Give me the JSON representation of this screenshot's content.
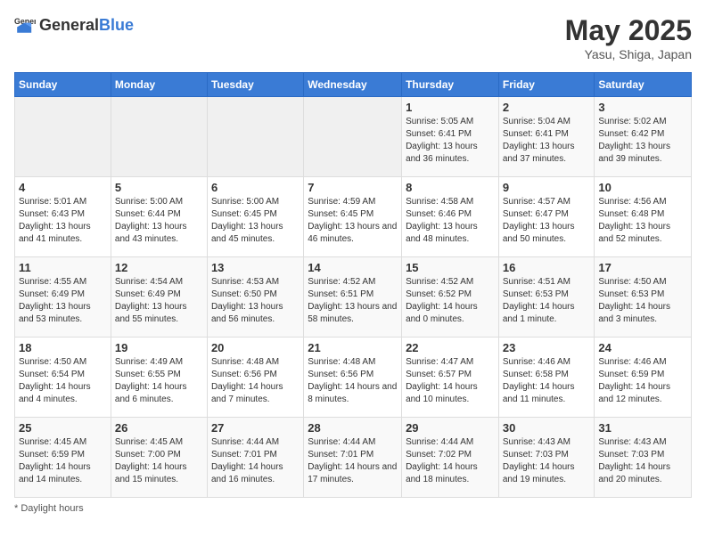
{
  "logo": {
    "text_general": "General",
    "text_blue": "Blue"
  },
  "header": {
    "month": "May 2025",
    "location": "Yasu, Shiga, Japan"
  },
  "days_of_week": [
    "Sunday",
    "Monday",
    "Tuesday",
    "Wednesday",
    "Thursday",
    "Friday",
    "Saturday"
  ],
  "footer": {
    "daylight_label": "Daylight hours"
  },
  "weeks": [
    [
      {
        "day": "",
        "sunrise": "",
        "sunset": "",
        "daylight": "",
        "empty": true
      },
      {
        "day": "",
        "sunrise": "",
        "sunset": "",
        "daylight": "",
        "empty": true
      },
      {
        "day": "",
        "sunrise": "",
        "sunset": "",
        "daylight": "",
        "empty": true
      },
      {
        "day": "",
        "sunrise": "",
        "sunset": "",
        "daylight": "",
        "empty": true
      },
      {
        "day": "1",
        "sunrise": "Sunrise: 5:05 AM",
        "sunset": "Sunset: 6:41 PM",
        "daylight": "Daylight: 13 hours and 36 minutes.",
        "empty": false
      },
      {
        "day": "2",
        "sunrise": "Sunrise: 5:04 AM",
        "sunset": "Sunset: 6:41 PM",
        "daylight": "Daylight: 13 hours and 37 minutes.",
        "empty": false
      },
      {
        "day": "3",
        "sunrise": "Sunrise: 5:02 AM",
        "sunset": "Sunset: 6:42 PM",
        "daylight": "Daylight: 13 hours and 39 minutes.",
        "empty": false
      }
    ],
    [
      {
        "day": "4",
        "sunrise": "Sunrise: 5:01 AM",
        "sunset": "Sunset: 6:43 PM",
        "daylight": "Daylight: 13 hours and 41 minutes.",
        "empty": false
      },
      {
        "day": "5",
        "sunrise": "Sunrise: 5:00 AM",
        "sunset": "Sunset: 6:44 PM",
        "daylight": "Daylight: 13 hours and 43 minutes.",
        "empty": false
      },
      {
        "day": "6",
        "sunrise": "Sunrise: 5:00 AM",
        "sunset": "Sunset: 6:45 PM",
        "daylight": "Daylight: 13 hours and 45 minutes.",
        "empty": false
      },
      {
        "day": "7",
        "sunrise": "Sunrise: 4:59 AM",
        "sunset": "Sunset: 6:45 PM",
        "daylight": "Daylight: 13 hours and 46 minutes.",
        "empty": false
      },
      {
        "day": "8",
        "sunrise": "Sunrise: 4:58 AM",
        "sunset": "Sunset: 6:46 PM",
        "daylight": "Daylight: 13 hours and 48 minutes.",
        "empty": false
      },
      {
        "day": "9",
        "sunrise": "Sunrise: 4:57 AM",
        "sunset": "Sunset: 6:47 PM",
        "daylight": "Daylight: 13 hours and 50 minutes.",
        "empty": false
      },
      {
        "day": "10",
        "sunrise": "Sunrise: 4:56 AM",
        "sunset": "Sunset: 6:48 PM",
        "daylight": "Daylight: 13 hours and 52 minutes.",
        "empty": false
      }
    ],
    [
      {
        "day": "11",
        "sunrise": "Sunrise: 4:55 AM",
        "sunset": "Sunset: 6:49 PM",
        "daylight": "Daylight: 13 hours and 53 minutes.",
        "empty": false
      },
      {
        "day": "12",
        "sunrise": "Sunrise: 4:54 AM",
        "sunset": "Sunset: 6:49 PM",
        "daylight": "Daylight: 13 hours and 55 minutes.",
        "empty": false
      },
      {
        "day": "13",
        "sunrise": "Sunrise: 4:53 AM",
        "sunset": "Sunset: 6:50 PM",
        "daylight": "Daylight: 13 hours and 56 minutes.",
        "empty": false
      },
      {
        "day": "14",
        "sunrise": "Sunrise: 4:52 AM",
        "sunset": "Sunset: 6:51 PM",
        "daylight": "Daylight: 13 hours and 58 minutes.",
        "empty": false
      },
      {
        "day": "15",
        "sunrise": "Sunrise: 4:52 AM",
        "sunset": "Sunset: 6:52 PM",
        "daylight": "Daylight: 14 hours and 0 minutes.",
        "empty": false
      },
      {
        "day": "16",
        "sunrise": "Sunrise: 4:51 AM",
        "sunset": "Sunset: 6:53 PM",
        "daylight": "Daylight: 14 hours and 1 minute.",
        "empty": false
      },
      {
        "day": "17",
        "sunrise": "Sunrise: 4:50 AM",
        "sunset": "Sunset: 6:53 PM",
        "daylight": "Daylight: 14 hours and 3 minutes.",
        "empty": false
      }
    ],
    [
      {
        "day": "18",
        "sunrise": "Sunrise: 4:50 AM",
        "sunset": "Sunset: 6:54 PM",
        "daylight": "Daylight: 14 hours and 4 minutes.",
        "empty": false
      },
      {
        "day": "19",
        "sunrise": "Sunrise: 4:49 AM",
        "sunset": "Sunset: 6:55 PM",
        "daylight": "Daylight: 14 hours and 6 minutes.",
        "empty": false
      },
      {
        "day": "20",
        "sunrise": "Sunrise: 4:48 AM",
        "sunset": "Sunset: 6:56 PM",
        "daylight": "Daylight: 14 hours and 7 minutes.",
        "empty": false
      },
      {
        "day": "21",
        "sunrise": "Sunrise: 4:48 AM",
        "sunset": "Sunset: 6:56 PM",
        "daylight": "Daylight: 14 hours and 8 minutes.",
        "empty": false
      },
      {
        "day": "22",
        "sunrise": "Sunrise: 4:47 AM",
        "sunset": "Sunset: 6:57 PM",
        "daylight": "Daylight: 14 hours and 10 minutes.",
        "empty": false
      },
      {
        "day": "23",
        "sunrise": "Sunrise: 4:46 AM",
        "sunset": "Sunset: 6:58 PM",
        "daylight": "Daylight: 14 hours and 11 minutes.",
        "empty": false
      },
      {
        "day": "24",
        "sunrise": "Sunrise: 4:46 AM",
        "sunset": "Sunset: 6:59 PM",
        "daylight": "Daylight: 14 hours and 12 minutes.",
        "empty": false
      }
    ],
    [
      {
        "day": "25",
        "sunrise": "Sunrise: 4:45 AM",
        "sunset": "Sunset: 6:59 PM",
        "daylight": "Daylight: 14 hours and 14 minutes.",
        "empty": false
      },
      {
        "day": "26",
        "sunrise": "Sunrise: 4:45 AM",
        "sunset": "Sunset: 7:00 PM",
        "daylight": "Daylight: 14 hours and 15 minutes.",
        "empty": false
      },
      {
        "day": "27",
        "sunrise": "Sunrise: 4:44 AM",
        "sunset": "Sunset: 7:01 PM",
        "daylight": "Daylight: 14 hours and 16 minutes.",
        "empty": false
      },
      {
        "day": "28",
        "sunrise": "Sunrise: 4:44 AM",
        "sunset": "Sunset: 7:01 PM",
        "daylight": "Daylight: 14 hours and 17 minutes.",
        "empty": false
      },
      {
        "day": "29",
        "sunrise": "Sunrise: 4:44 AM",
        "sunset": "Sunset: 7:02 PM",
        "daylight": "Daylight: 14 hours and 18 minutes.",
        "empty": false
      },
      {
        "day": "30",
        "sunrise": "Sunrise: 4:43 AM",
        "sunset": "Sunset: 7:03 PM",
        "daylight": "Daylight: 14 hours and 19 minutes.",
        "empty": false
      },
      {
        "day": "31",
        "sunrise": "Sunrise: 4:43 AM",
        "sunset": "Sunset: 7:03 PM",
        "daylight": "Daylight: 14 hours and 20 minutes.",
        "empty": false
      }
    ]
  ]
}
